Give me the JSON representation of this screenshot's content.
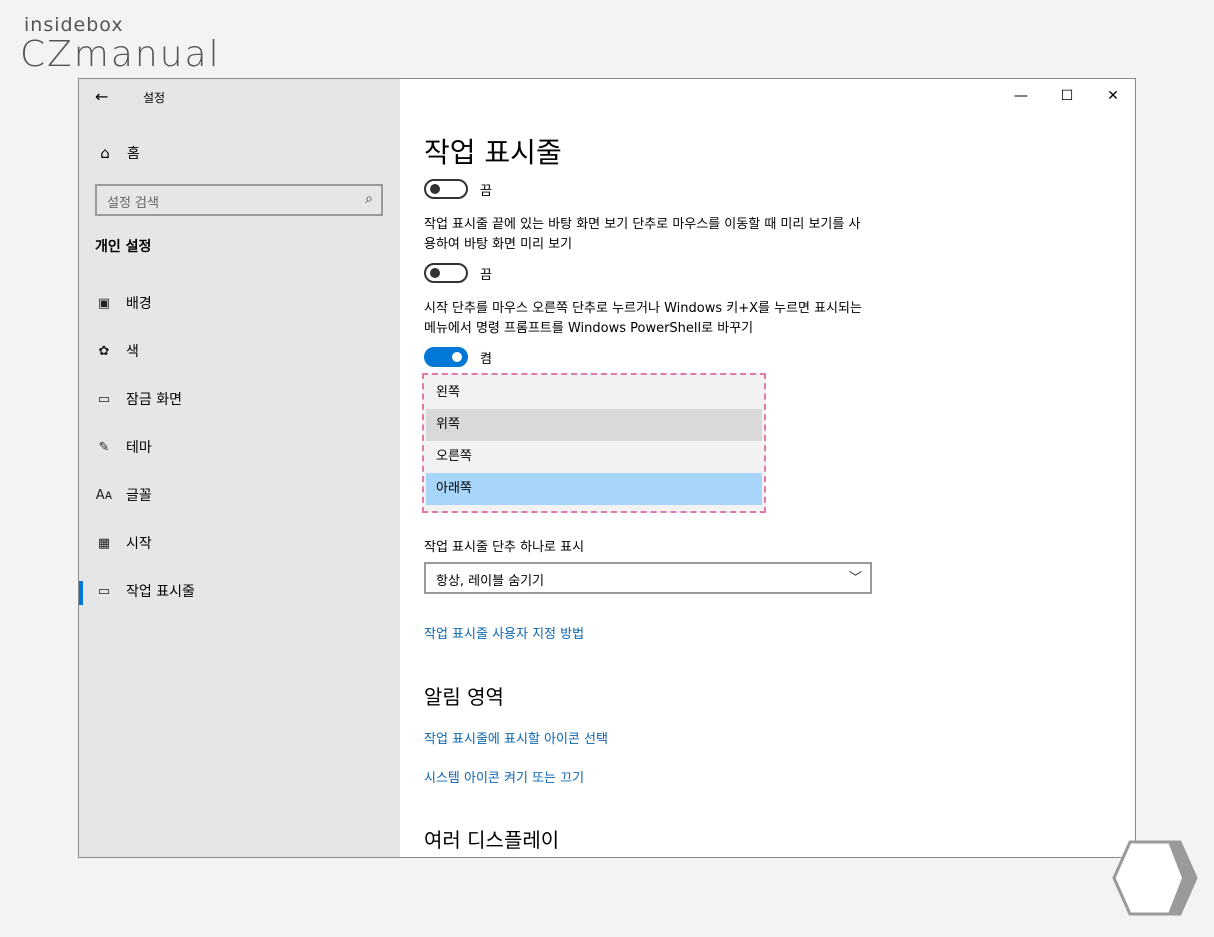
{
  "watermark": {
    "top": "insidebox",
    "main": "CZmanual"
  },
  "window": {
    "title": "설정",
    "controls": {
      "minimize": "—",
      "maximize": "☐",
      "close": "✕"
    }
  },
  "sidebar": {
    "home": "홈",
    "search_placeholder": "설정 검색",
    "section_title": "개인 설정",
    "items": [
      {
        "label": "배경",
        "icon": "picture-icon"
      },
      {
        "label": "색",
        "icon": "palette-icon"
      },
      {
        "label": "잠금 화면",
        "icon": "lock-screen-icon"
      },
      {
        "label": "테마",
        "icon": "theme-icon"
      },
      {
        "label": "글꼴",
        "icon": "font-icon"
      },
      {
        "label": "시작",
        "icon": "start-icon"
      },
      {
        "label": "작업 표시줄",
        "icon": "taskbar-icon",
        "active": true
      }
    ]
  },
  "main": {
    "title": "작업 표시줄",
    "toggle1": {
      "state": "끔"
    },
    "desc2": "작업 표시줄 끝에 있는 바탕 화면 보기 단추로 마우스를 이동할 때 미리 보기를 사용하여 바탕 화면 미리 보기",
    "toggle2": {
      "state": "끔"
    },
    "desc3": "시작 단추를 마우스 오른쪽 단추로 누르거나 Windows 키+X를 누르면 표시되는 메뉴에서 명령 프롬프트를 Windows PowerShell로 바꾸기",
    "toggle3": {
      "state": "켬"
    },
    "position_options": [
      "왼쪽",
      "위쪽",
      "오른쪽",
      "아래쪽"
    ],
    "combine_label": "작업 표시줄 단추 하나로 표시",
    "combine_value": "항상, 레이블 숨기기",
    "link_customize": "작업 표시줄 사용자 지정 방법",
    "notification_title": "알림 영역",
    "link_select_icons": "작업 표시줄에 표시할 아이콘 선택",
    "link_system_icons": "시스템 아이콘 켜기 또는 끄기",
    "multi_display_title": "여러 디스플레이"
  },
  "colors": {
    "accent": "#0078d7",
    "link": "#0a66b3",
    "selected": "#a8d6fb",
    "highlight_border": "#e07aa8"
  }
}
